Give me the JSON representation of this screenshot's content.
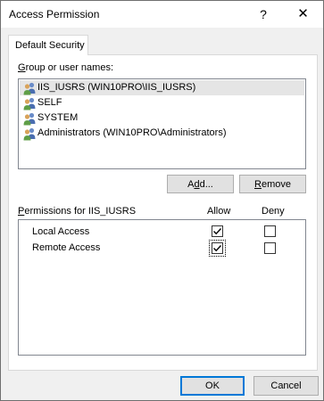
{
  "window": {
    "title": "Access Permission",
    "help_glyph": "?",
    "close_glyph": "✕"
  },
  "tab": {
    "label": "Default Security"
  },
  "group": {
    "label_accel": "G",
    "label_rest": "roup or user names:",
    "items": [
      {
        "name": "IIS_IUSRS (WIN10PRO\\IIS_IUSRS)",
        "selected": true
      },
      {
        "name": "SELF",
        "selected": false
      },
      {
        "name": "SYSTEM",
        "selected": false
      },
      {
        "name": "Administrators (WIN10PRO\\Administrators)",
        "selected": false
      }
    ]
  },
  "buttons": {
    "add_pre": "A",
    "add_accel": "d",
    "add_post": "d...",
    "remove_accel": "R",
    "remove_rest": "emove",
    "ok": "OK",
    "cancel": "Cancel"
  },
  "permissions": {
    "label_accel": "P",
    "label_rest": "ermissions for IIS_IUSRS",
    "col_allow": "Allow",
    "col_deny": "Deny",
    "rows": [
      {
        "name": "Local Access",
        "allow": true,
        "deny": false
      },
      {
        "name": "Remote Access",
        "allow": true,
        "deny": false
      }
    ]
  }
}
